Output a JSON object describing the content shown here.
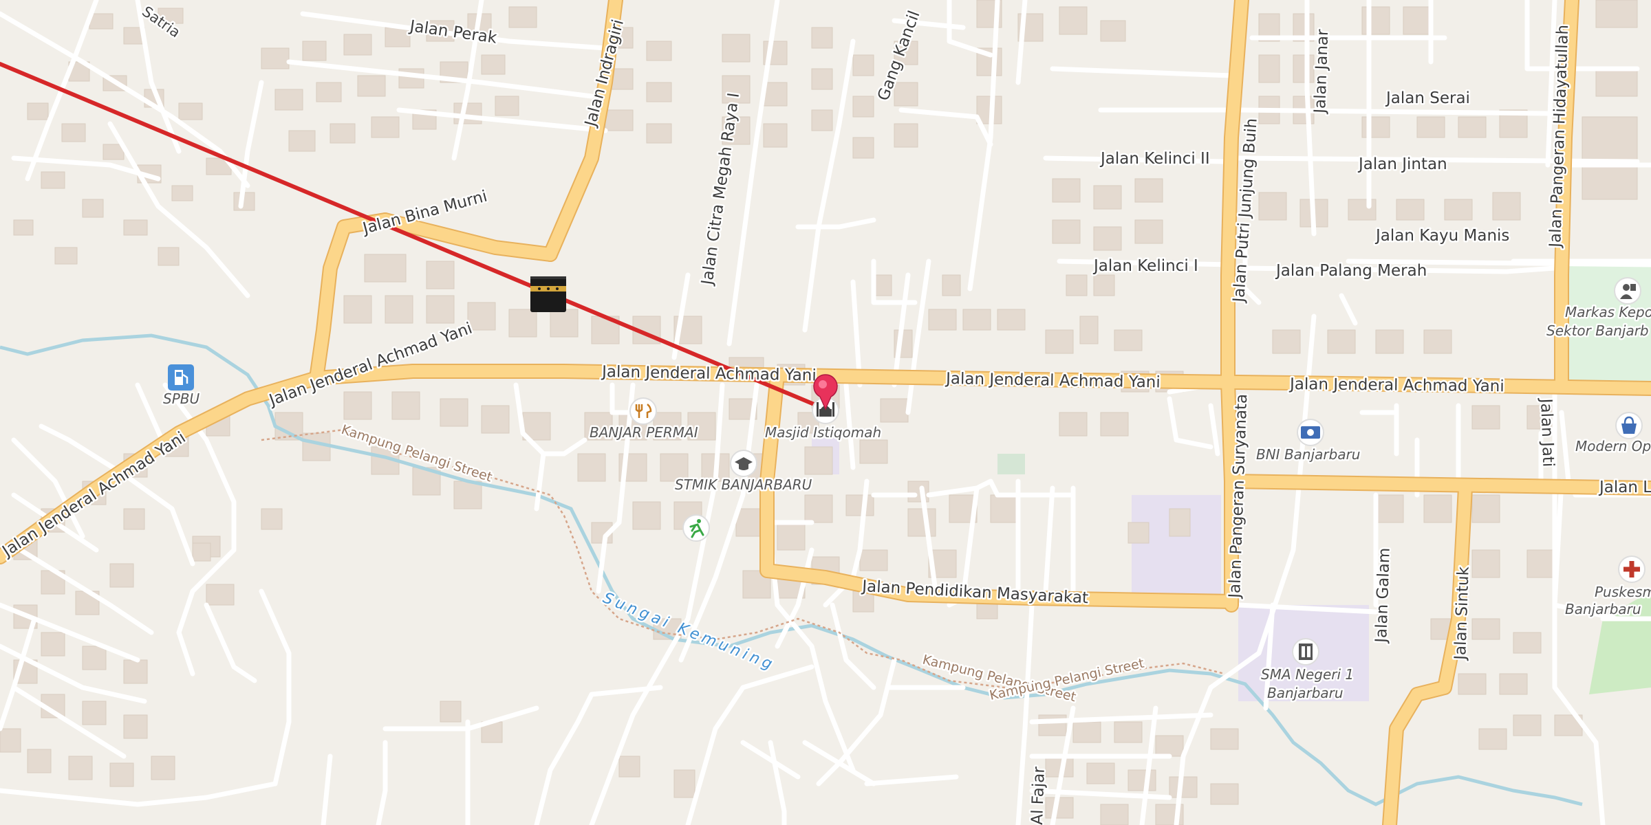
{
  "map": {
    "colors": {
      "land": "#f2efe9",
      "building": "#e4dad0",
      "road_major": "#fcd68a",
      "road_major_casing": "#e8b15c",
      "road_minor": "#ffffff",
      "water": "#aad3df",
      "route": "#d62728",
      "marker": "#e8325b"
    },
    "streets": {
      "satria": "Satria",
      "perak": "Jalan Perak",
      "indragiri": "Jalan Indragiri",
      "gang_kancil": "Gang Kancil",
      "citra_megah": "Jalan Citra Megah Raya I",
      "bina_murni": "Jalan Bina Murni",
      "ahmad_yani_1": "Jalan Jenderal Achmad Yani",
      "ahmad_yani_2": "Jalan Jenderal Achmad Yani",
      "ahmad_yani_3": "Jalan Jenderal Achmad Yani",
      "ahmad_yani_4": "Jalan Jenderal Achmad Yani",
      "ahmad_yani_5": "Jalan Jenderal Achmad Yani",
      "kelinci_ii": "Jalan Kelinci II",
      "kelinci_i": "Jalan Kelinci I",
      "putri_junjung_buih": "Jalan Putri Junjung Buih",
      "janar": "Jalan Janar",
      "serai": "Jalan Serai",
      "jintan": "Jalan Jintan",
      "kayu_manis": "Jalan Kayu Manis",
      "palang_merah": "Jalan Palang Merah",
      "pangeran_hidayatullah": "Jalan Pangeran Hidayatullah",
      "pangeran_suryanata": "Jalan Pangeran Suryanata",
      "pendidikan": "Jalan Pendidikan Masyarakat",
      "galam": "Jalan Galam",
      "sintuk": "Jalan Sintuk",
      "jati": "Jalan Jati",
      "al_fajar": "Al Fajar",
      "jalan_l": "Jalan L"
    },
    "paths": {
      "pelangi_1": "Kampung Pelangi Street",
      "pelangi_2": "Kampung Pelangi Street",
      "pelangi_3": "Kampung Pelangi Street"
    },
    "river": "Sungai Kemuning",
    "pois": {
      "spbu": "SPBU",
      "banjar_permai": "BANJAR PERMAI",
      "masjid": "Masjid Istiqomah",
      "stmik": "STMIK BANJARBARU",
      "bni": "BNI Banjarbaru",
      "sma_1": "SMA Negeri 1",
      "sma_2": "Banjarbaru",
      "markas_1": "Markas Kepo",
      "markas_2": "Sektor Banjarb",
      "modern": "Modern Op",
      "puskesmas_1": "Puskesm",
      "puskesmas_2": "Banjarbaru"
    },
    "icons": {
      "kaaba": "kaaba-icon",
      "fuel": "fuel-station-icon",
      "restaurant": "restaurant-icon",
      "mosque": "mosque-icon",
      "university": "graduation-cap-icon",
      "sports": "running-icon",
      "bank": "bank-icon",
      "school": "school-icon",
      "police": "police-icon",
      "shop": "shopping-bag-icon",
      "clinic": "medical-cross-icon",
      "marker": "location-pin-icon"
    }
  }
}
